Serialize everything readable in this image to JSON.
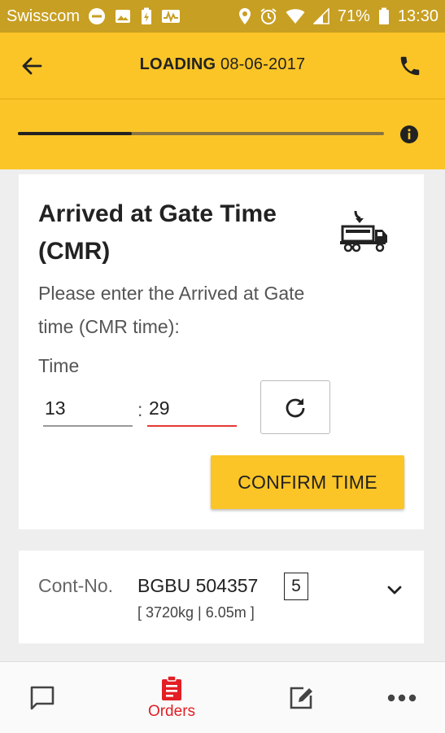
{
  "status_bar": {
    "carrier": "Swisscom",
    "battery": "71%",
    "time": "13:30"
  },
  "header": {
    "title_bold": "LOADING",
    "title_date": "08-06-2017"
  },
  "progress": {
    "fraction": 0.31
  },
  "step_card": {
    "title": "Arrived at Gate Time (CMR)",
    "description": "Please enter the Arrived at Gate time (CMR time):",
    "time_label": "Time",
    "hour_value": "13",
    "separator": ":",
    "minute_value": "29",
    "confirm_label": "CONFIRM TIME"
  },
  "container": {
    "label": "Cont-No.",
    "number": "BGBU 504357",
    "badge": "5",
    "details": "[ 3720kg | 6.05m ]"
  },
  "bottom_nav": {
    "orders_label": "Orders"
  },
  "colors": {
    "brand_yellow": "#fbc527",
    "status_bar": "#c79f22",
    "accent_red": "#e31e24",
    "input_underline_active": "#e53935"
  }
}
